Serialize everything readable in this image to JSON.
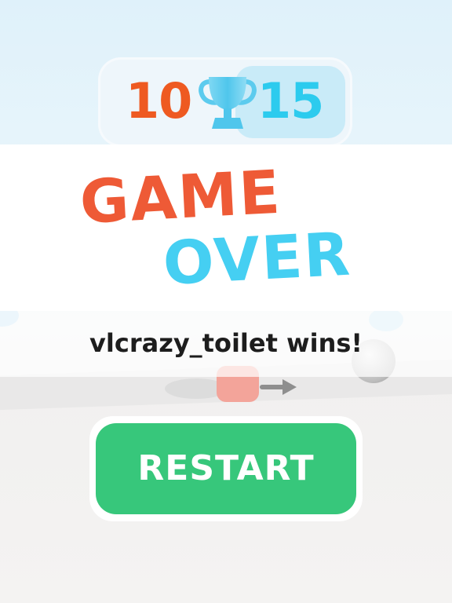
{
  "scoreboard": {
    "left_score": "10",
    "right_score": "15",
    "left_color": "#ee5a21",
    "right_color": "#2ccbee",
    "center_icon": "trophy-icon"
  },
  "result": {
    "title_line1": "GAME",
    "title_line2": "OVER",
    "title_line1_color": "#ee5a36",
    "title_line2_color": "#45cff2",
    "winner_text": "vlcrazy_toilet wins!"
  },
  "actions": {
    "restart_label": "RESTART",
    "restart_color": "#37c77b"
  }
}
